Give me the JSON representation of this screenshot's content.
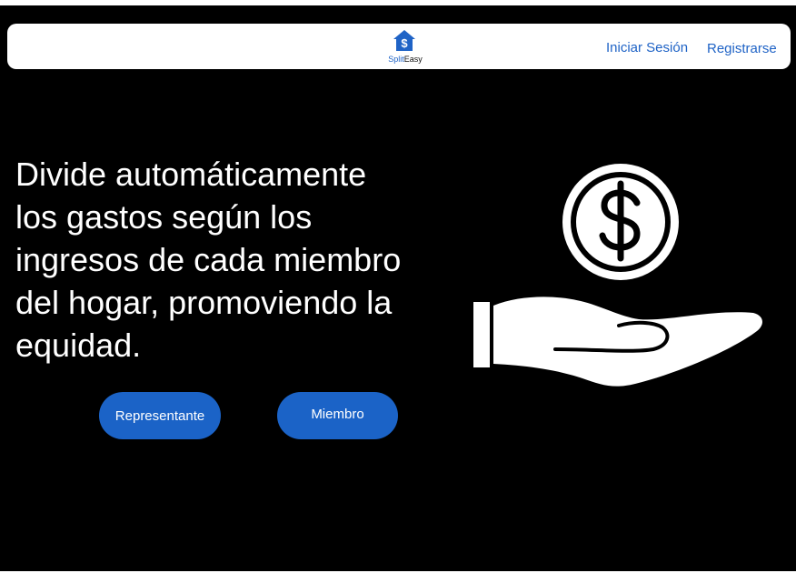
{
  "navbar": {
    "logo": {
      "icon": "house-dollar-icon",
      "text_part1": "Split",
      "text_part2": "Easy"
    },
    "login_label": "Iniciar Sesión",
    "register_label": "Registrarse"
  },
  "hero": {
    "headline_lines": [
      "Divide automáticamente",
      "los gastos según los",
      "ingresos de cada miembro",
      "del hogar, promoviendo la",
      "equidad."
    ],
    "illustration": "hand-holding-dollar-icon"
  },
  "actions": {
    "representative_label": "Representante",
    "member_label": "Miembro"
  },
  "colors": {
    "background": "#000000",
    "navbar": "#ffffff",
    "accent": "#1b63c7",
    "link": "#1f63c6"
  }
}
